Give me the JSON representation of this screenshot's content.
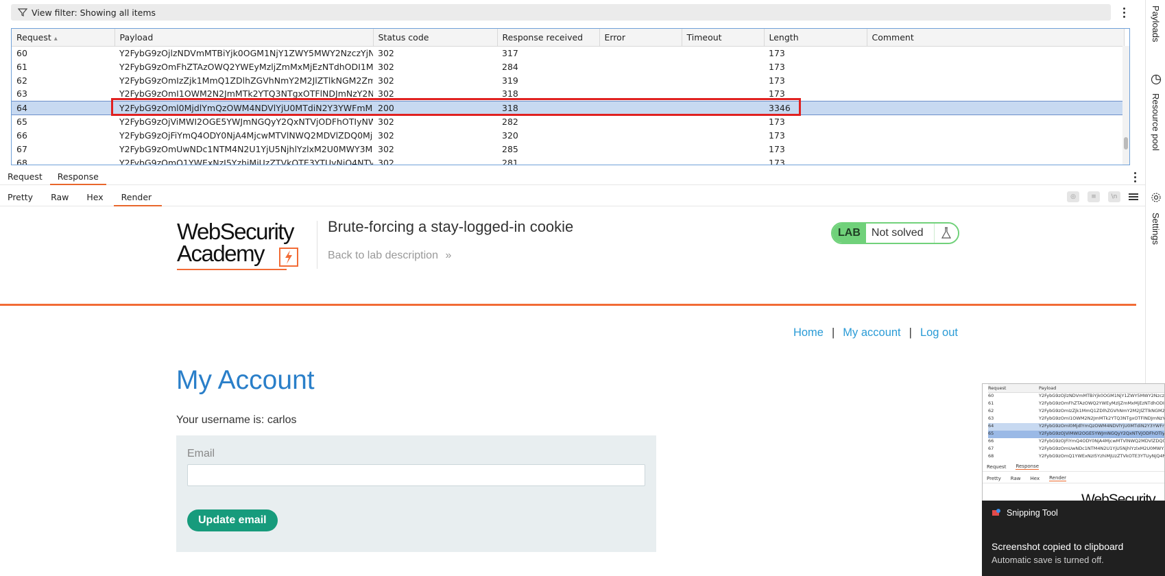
{
  "filter": {
    "label": "View filter: Showing all items"
  },
  "table": {
    "columns": [
      "Request",
      "Payload",
      "Status code",
      "Response received",
      "Error",
      "Timeout",
      "Length",
      "Comment"
    ],
    "rows": [
      {
        "request": "60",
        "payload": "Y2FybG9zOjlzNDVmMTBiYjk0OGM1NjY1ZWY5MWY2NzczYjNl...",
        "status": "302",
        "received": "317",
        "error": "",
        "timeout": "",
        "length": "173",
        "comment": ""
      },
      {
        "request": "61",
        "payload": "Y2FybG9zOmFhZTAzOWQ2YWEyMzljZmMxMjEzNTdhODI1MjE...",
        "status": "302",
        "received": "284",
        "error": "",
        "timeout": "",
        "length": "173",
        "comment": ""
      },
      {
        "request": "62",
        "payload": "Y2FybG9zOmIzZjk1MmQ1ZDlhZGVhNmY2M2JlZTlkNGM2ZmNl...",
        "status": "302",
        "received": "319",
        "error": "",
        "timeout": "",
        "length": "173",
        "comment": ""
      },
      {
        "request": "63",
        "payload": "Y2FybG9zOmI1OWM2N2JmMTk2YTQ3NTgxOTFlNDJmNzY2Nz...",
        "status": "302",
        "received": "318",
        "error": "",
        "timeout": "",
        "length": "173",
        "comment": ""
      },
      {
        "request": "64",
        "payload": "Y2FybG9zOml0MjdlYmQzOWM4NDVlYjU0MTdiN2Y3YWFmM...",
        "status": "200",
        "received": "318",
        "error": "",
        "timeout": "",
        "length": "3346",
        "comment": ""
      },
      {
        "request": "65",
        "payload": "Y2FybG9zOjViMWI2OGE5YWJmNGQyY2QxNTVjODFhOTIyNWZ...",
        "status": "302",
        "received": "282",
        "error": "",
        "timeout": "",
        "length": "173",
        "comment": ""
      },
      {
        "request": "66",
        "payload": "Y2FybG9zOjFiYmQ4ODY0NjA4MjcwMTVlNWQ2MDVlZDQ0MjU...",
        "status": "302",
        "received": "320",
        "error": "",
        "timeout": "",
        "length": "173",
        "comment": ""
      },
      {
        "request": "67",
        "payload": "Y2FybG9zOmUwNDc1NTM4N2U1YjU5NjhlYzlxM2U0MWY3MG...",
        "status": "302",
        "received": "285",
        "error": "",
        "timeout": "",
        "length": "173",
        "comment": ""
      },
      {
        "request": "68",
        "payload": "Y2FybG9zOmQ1YWExNzI5YzhiMjUzZTVkOTE3YTUyNjQ4NTVlY...",
        "status": "302",
        "received": "281",
        "error": "",
        "timeout": "",
        "length": "173",
        "comment": ""
      }
    ],
    "selected_request": "64"
  },
  "tabs_primary": [
    "Request",
    "Response"
  ],
  "tabs_secondary": [
    "Pretty",
    "Raw",
    "Hex",
    "Render"
  ],
  "render": {
    "logo_line1": "WebSecurity",
    "logo_line2": "Academy",
    "lab_title": "Brute-forcing a stay-logged-in cookie",
    "back_link": "Back to lab description",
    "lab_label": "LAB",
    "lab_status": "Not solved",
    "nav": {
      "home": "Home",
      "account": "My account",
      "logout": "Log out",
      "sep": "|"
    },
    "heading": "My Account",
    "username_line": "Your username is: carlos",
    "email_label": "Email",
    "update_button": "Update email"
  },
  "sidebar": {
    "payloads": "Payloads",
    "resource_pool": "Resource pool",
    "settings": "Settings"
  },
  "toast": {
    "app": "Snipping Tool",
    "title": "Screenshot copied to clipboard",
    "subtitle": "Automatic save is turned off."
  },
  "colors": {
    "accent": "#e8662b",
    "selection": "#c7d9f1",
    "highlight_box": "#e02020",
    "lab_green": "#70d17a",
    "link": "#2a9bd6",
    "heading": "#2a7fc9",
    "button": "#179b7c"
  }
}
